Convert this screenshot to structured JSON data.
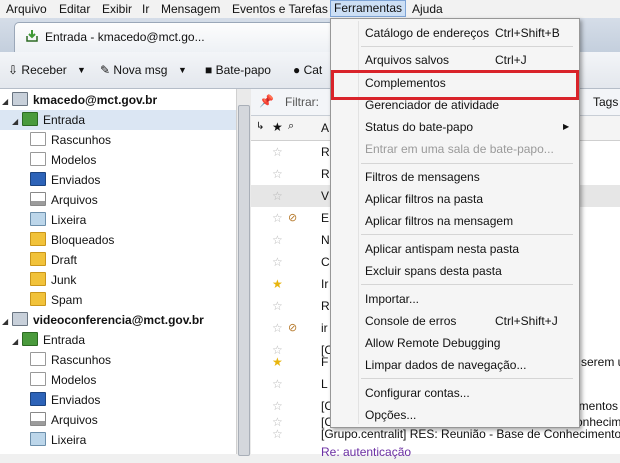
{
  "menubar": {
    "items": [
      "Arquivo",
      "Editar",
      "Exibir",
      "Ir",
      "Mensagem",
      "Eventos e Tarefas",
      "Ferramentas",
      "Ajuda"
    ]
  },
  "tab": {
    "label": "Entrada - kmacedo@mct.go..."
  },
  "toolbar": {
    "receive": "Receber",
    "new_msg": "Nova msg",
    "chat": "Bate-papo",
    "contacts": "Cat"
  },
  "folder_pane": {
    "account1": "kmacedo@mct.gov.br",
    "account1_folders": [
      "Entrada",
      "Rascunhos",
      "Modelos",
      "Enviados",
      "Arquivos",
      "Lixeira",
      "Bloqueados",
      "Draft",
      "Junk",
      "Spam"
    ],
    "account2": "videoconferencia@mct.gov.br",
    "account2_folders": [
      "Entrada",
      "Rascunhos",
      "Modelos",
      "Enviados",
      "Arquivos",
      "Lixeira"
    ]
  },
  "filter": {
    "label": "Filtrar:",
    "tags": "Tags"
  },
  "columns": {
    "subject_initial": "A"
  },
  "messages": [
    {
      "text": "R",
      "starred": false,
      "attach": false
    },
    {
      "text": "R",
      "starred": false,
      "attach": false
    },
    {
      "text": "V",
      "starred": false,
      "attach": false
    },
    {
      "text": "E",
      "starred": false,
      "attach": true
    },
    {
      "text": "N",
      "starred": false,
      "attach": false
    },
    {
      "text": "C",
      "starred": false,
      "attach": false
    },
    {
      "text": "Ir",
      "starred": true,
      "attach": false
    },
    {
      "text": "R",
      "starred": false,
      "attach": false
    },
    {
      "text": "ir",
      "starred": false,
      "attach": true
    },
    {
      "text": "[C",
      "starred": false,
      "attach": false
    },
    {
      "text": "F",
      "starred": true,
      "attach": false
    },
    {
      "text": "L",
      "starred": false,
      "attach": false
    },
    {
      "text": "[C",
      "starred": false,
      "attach": false
    },
    {
      "text": "[C",
      "starred": false,
      "attach": false
    },
    {
      "text": "[Grupo.centralit] RES:  Reunião - Base de Conhecimento,",
      "starred": false,
      "attach": false
    },
    {
      "text": "Re: autenticação",
      "starred": false,
      "attach": false
    }
  ],
  "right_fragments": {
    "f1": "serem u",
    "f2": "imentos",
    "f3": "onhecim"
  },
  "tools_menu": {
    "items": [
      {
        "label": "Catálogo de endereços",
        "shortcut": "Ctrl+Shift+B",
        "disabled": false
      },
      {
        "label": "Arquivos salvos",
        "shortcut": "Ctrl+J",
        "disabled": false
      },
      {
        "label": "Complementos",
        "shortcut": "",
        "disabled": false
      },
      {
        "label": "Gerenciador de atividade",
        "shortcut": "",
        "disabled": false
      },
      {
        "label": "Status do bate-papo",
        "shortcut": "",
        "disabled": false
      },
      {
        "label": "Entrar em uma sala de bate-papo...",
        "shortcut": "",
        "disabled": true
      },
      {
        "label": "Filtros de mensagens",
        "shortcut": "",
        "disabled": false
      },
      {
        "label": "Aplicar filtros na pasta",
        "shortcut": "",
        "disabled": false
      },
      {
        "label": "Aplicar filtros na mensagem",
        "shortcut": "",
        "disabled": false
      },
      {
        "label": "Aplicar antispam nesta pasta",
        "shortcut": "",
        "disabled": false
      },
      {
        "label": "Excluir spans desta pasta",
        "shortcut": "",
        "disabled": false
      },
      {
        "label": "Importar...",
        "shortcut": "",
        "disabled": false
      },
      {
        "label": "Console de erros",
        "shortcut": "Ctrl+Shift+J",
        "disabled": false
      },
      {
        "label": "Allow Remote Debugging",
        "shortcut": "",
        "disabled": false
      },
      {
        "label": "Limpar dados de navegação...",
        "shortcut": "",
        "disabled": false
      },
      {
        "label": "Configurar contas...",
        "shortcut": "",
        "disabled": false
      },
      {
        "label": "Opções...",
        "shortcut": "",
        "disabled": false
      }
    ]
  },
  "colors": {
    "highlight_border": "#d9232a",
    "menu_active": "#ccdff5"
  }
}
